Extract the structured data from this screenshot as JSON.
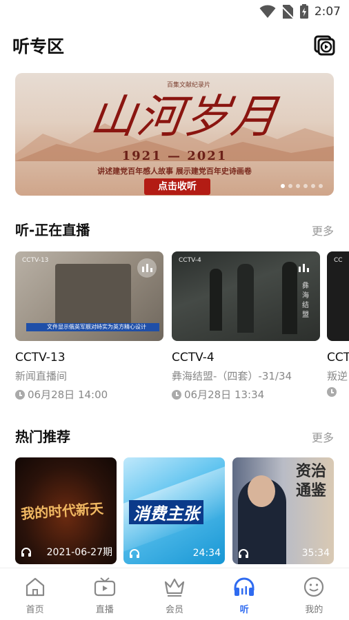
{
  "status_bar": {
    "time": "2:07"
  },
  "header": {
    "title": "听专区",
    "history_icon": "history-play-icon"
  },
  "banner": {
    "calligraphy": "山河岁月",
    "tag": "百集文献纪录片",
    "years": "1921 — 2021",
    "subtitle": "讲述建党百年感人故事 展示建党百年史诗画卷",
    "cta": "点击收听",
    "dots_count": 6,
    "active_dot": 0
  },
  "live_section": {
    "title": "听-正在直播",
    "more": "更多",
    "cards": [
      {
        "channel": "CCTV-13",
        "program": "新闻直播间",
        "time": "06月28日 14:00",
        "thumb_caption": "文件显示俄英军舰对峙实为英方精心设计"
      },
      {
        "channel": "CCTV-4",
        "program": "彝海结盟-（四套）-31/34",
        "time": "06月28日 13:34",
        "thumb_caption": "彝海结盟"
      },
      {
        "channel": "CCT",
        "program": "叛逆",
        "time": ""
      }
    ]
  },
  "hot_section": {
    "title": "热门推荐",
    "more": "更多",
    "cards": [
      {
        "label": "2021-06-27期",
        "art": "我的时代新天"
      },
      {
        "label": "24:34",
        "art": "消费主张"
      },
      {
        "label": "35:34",
        "art": "资治通鉴"
      }
    ]
  },
  "tabbar": {
    "active": 3,
    "items": [
      {
        "label": "首页",
        "icon": "home-icon"
      },
      {
        "label": "直播",
        "icon": "tv-icon"
      },
      {
        "label": "会员",
        "icon": "crown-icon"
      },
      {
        "label": "听",
        "icon": "headphones-icon"
      },
      {
        "label": "我的",
        "icon": "smile-face-icon"
      }
    ]
  },
  "colors": {
    "accent": "#2f6bf0",
    "muted": "#888888",
    "banner_cta": "#b31c14"
  }
}
